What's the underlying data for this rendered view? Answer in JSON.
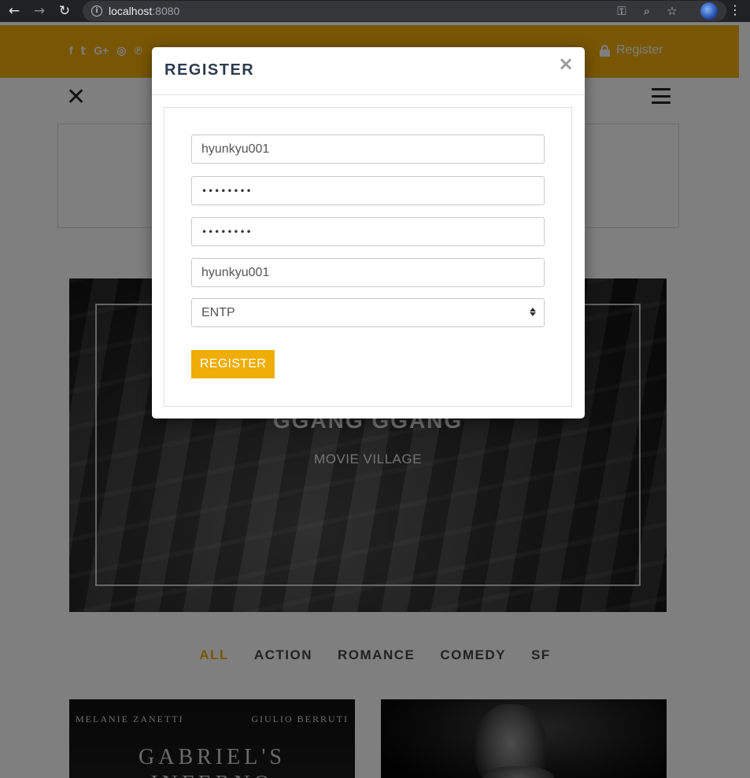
{
  "browser": {
    "url_host": "localhost",
    "url_port": ":8080",
    "icons": [
      "back-icon",
      "forward-icon",
      "reload-icon",
      "info-icon",
      "key-icon",
      "zoom-icon",
      "star-icon",
      "profile-avatar",
      "menu-kebab-icon"
    ]
  },
  "topbar": {
    "social_icons": [
      "facebook-icon",
      "twitter-icon",
      "google-plus-icon",
      "instagram-icon",
      "pinterest-icon"
    ],
    "social_glyphs": [
      "f",
      "𝕥",
      "G+",
      "◎",
      "℗"
    ],
    "register_label": "Register",
    "accent_color": "#f0ad06"
  },
  "hero": {
    "title": "GGANG GGANG",
    "subtitle": "MOVIE VILLAGE"
  },
  "filters": [
    {
      "label": "ALL",
      "active": true
    },
    {
      "label": "ACTION",
      "active": false
    },
    {
      "label": "ROMANCE",
      "active": false
    },
    {
      "label": "COMEDY",
      "active": false
    },
    {
      "label": "SF",
      "active": false
    }
  ],
  "posters": [
    {
      "names_left": "MELANIE ZANETTI",
      "names_right": "GIULIO BERRUTI",
      "title_line1": "GABRIEL'S",
      "title_line2": "INFERNO"
    },
    {}
  ],
  "modal": {
    "title": "REGISTER",
    "close_glyph": "×",
    "fields": {
      "username_value": "hyunkyu001",
      "password_value": "••••••••",
      "password_confirm_value": "••••••••",
      "name_value": "hyunkyu001",
      "mbti_selected": "ENTP"
    },
    "submit_label": "REGISTER"
  }
}
